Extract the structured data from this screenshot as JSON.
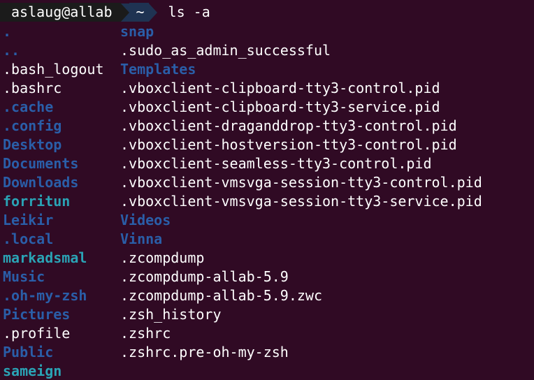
{
  "window": {
    "background": "#300a24"
  },
  "colors": {
    "dir": "#2a5ea8",
    "file": "#ffffff",
    "link": "#2aa3b5"
  },
  "prompt": {
    "user_host": "aslaug@allab",
    "dir": "~",
    "command": "ls -a"
  },
  "listing": {
    "col1": [
      {
        "name": ".",
        "type": "dir"
      },
      {
        "name": "..",
        "type": "dir"
      },
      {
        "name": ".bash_logout",
        "type": "file"
      },
      {
        "name": ".bashrc",
        "type": "file"
      },
      {
        "name": ".cache",
        "type": "dir"
      },
      {
        "name": ".config",
        "type": "dir"
      },
      {
        "name": "Desktop",
        "type": "dir"
      },
      {
        "name": "Documents",
        "type": "dir"
      },
      {
        "name": "Downloads",
        "type": "dir"
      },
      {
        "name": "forritun",
        "type": "link"
      },
      {
        "name": "Leikir",
        "type": "dir"
      },
      {
        "name": ".local",
        "type": "dir"
      },
      {
        "name": "markadsmal",
        "type": "link"
      },
      {
        "name": "Music",
        "type": "dir"
      },
      {
        "name": ".oh-my-zsh",
        "type": "dir"
      },
      {
        "name": "Pictures",
        "type": "dir"
      },
      {
        "name": ".profile",
        "type": "file"
      },
      {
        "name": "Public",
        "type": "dir"
      },
      {
        "name": "sameign",
        "type": "link"
      }
    ],
    "col2": [
      {
        "name": "snap",
        "type": "dir"
      },
      {
        "name": ".sudo_as_admin_successful",
        "type": "file"
      },
      {
        "name": "Templates",
        "type": "dir"
      },
      {
        "name": ".vboxclient-clipboard-tty3-control.pid",
        "type": "file"
      },
      {
        "name": ".vboxclient-clipboard-tty3-service.pid",
        "type": "file"
      },
      {
        "name": ".vboxclient-draganddrop-tty3-control.pid",
        "type": "file"
      },
      {
        "name": ".vboxclient-hostversion-tty3-control.pid",
        "type": "file"
      },
      {
        "name": ".vboxclient-seamless-tty3-control.pid",
        "type": "file"
      },
      {
        "name": ".vboxclient-vmsvga-session-tty3-control.pid",
        "type": "file"
      },
      {
        "name": ".vboxclient-vmsvga-session-tty3-service.pid",
        "type": "file"
      },
      {
        "name": "Videos",
        "type": "dir"
      },
      {
        "name": "Vinna",
        "type": "dir"
      },
      {
        "name": ".zcompdump",
        "type": "file"
      },
      {
        "name": ".zcompdump-allab-5.9",
        "type": "file"
      },
      {
        "name": ".zcompdump-allab-5.9.zwc",
        "type": "file"
      },
      {
        "name": ".zsh_history",
        "type": "file"
      },
      {
        "name": ".zshrc",
        "type": "file"
      },
      {
        "name": ".zshrc.pre-oh-my-zsh",
        "type": "file"
      }
    ]
  }
}
